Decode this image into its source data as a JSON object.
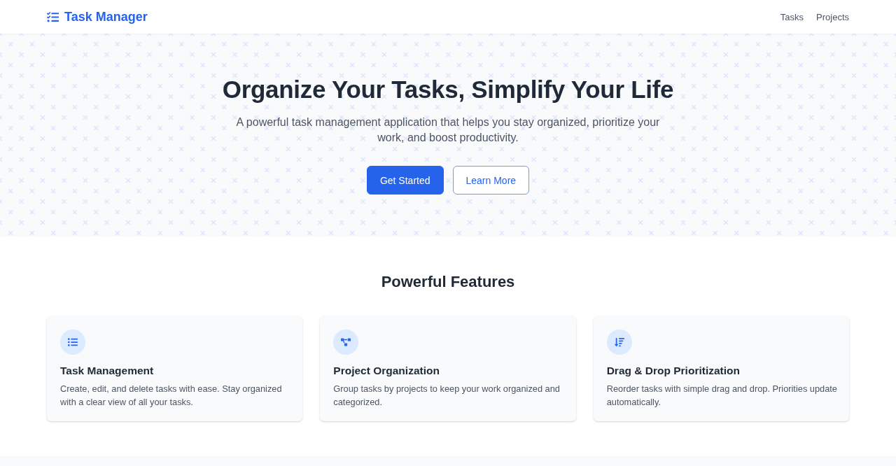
{
  "header": {
    "logo": "Task Manager",
    "nav": [
      {
        "label": "Tasks"
      },
      {
        "label": "Projects"
      }
    ]
  },
  "hero": {
    "title": "Organize Your Tasks, Simplify Your Life",
    "subtitle": "A powerful task management application that helps you stay organized, prioritize your work, and boost productivity.",
    "buttons": [
      {
        "label": "Get Started",
        "kind": "primary"
      },
      {
        "label": "Learn More",
        "kind": "outline"
      }
    ]
  },
  "features": {
    "heading": "Powerful Features",
    "cards": [
      {
        "title": "Task Management",
        "description": "Create, edit, and delete tasks with ease. Stay organized with a clear view of all your tasks."
      },
      {
        "title": "Project Organization",
        "description": "Group tasks by projects to keep your work organized and categorized."
      },
      {
        "title": "Drag & Drop Prioritization",
        "description": "Reorder tasks with simple drag and drop. Priorities update automatically."
      }
    ]
  }
}
